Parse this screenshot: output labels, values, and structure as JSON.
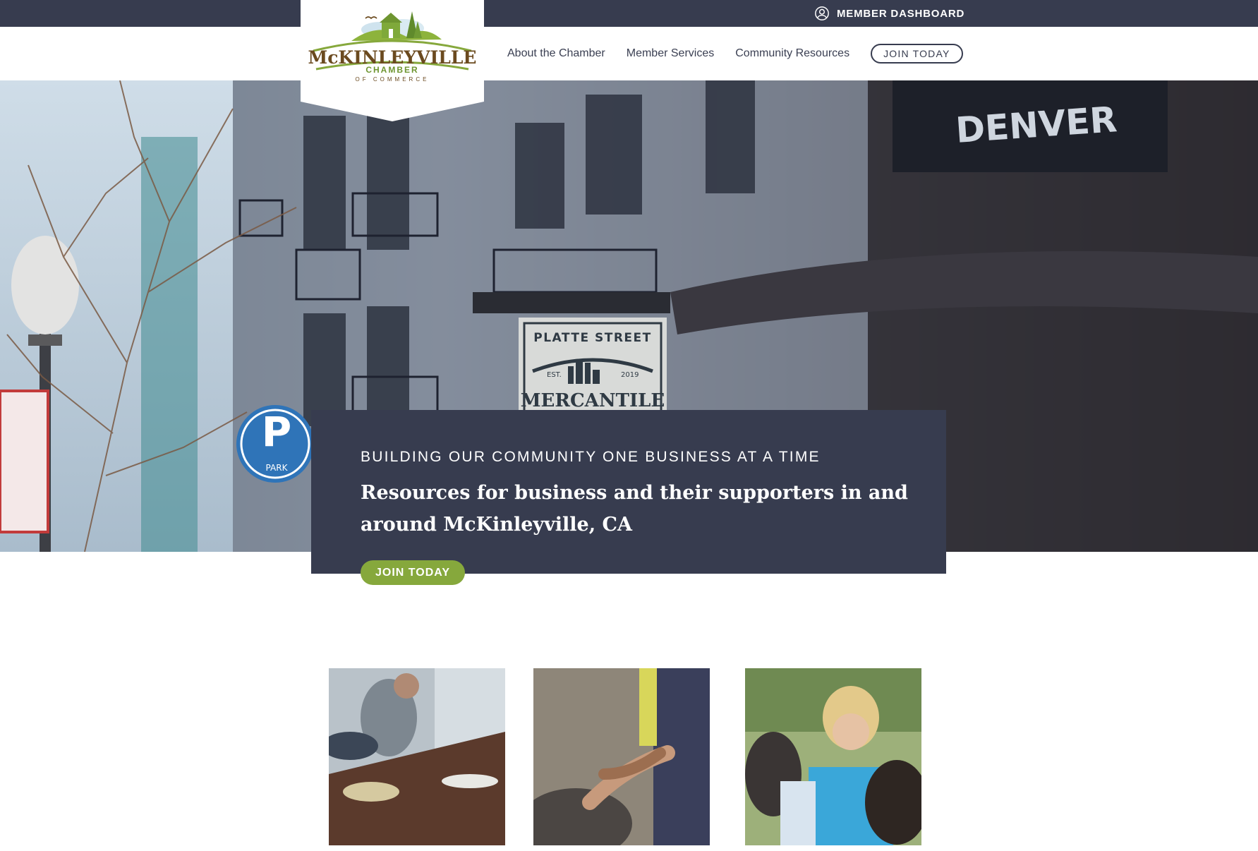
{
  "header": {
    "member_link": {
      "label": "MEMBER DASHBOARD",
      "icon": "user-circle-icon"
    },
    "logo": {
      "brand": "McKINLEYVILLE",
      "line2": "CHAMBER",
      "line3": "OF COMMERCE"
    },
    "nav": [
      {
        "label": "About the Chamber"
      },
      {
        "label": "Member Services"
      },
      {
        "label": "Community Resources"
      }
    ],
    "join_button": "JOIN TODAY"
  },
  "hero": {
    "kicker": "BUILDING OUR COMMUNITY ONE BUSINESS AT A TIME",
    "headline": "Resources for business and their supporters in and around McKinleyville, CA",
    "cta": "JOIN TODAY",
    "sign_text": {
      "line1": "PLATTE STREET",
      "est": "EST.",
      "year": "2019",
      "line2": "MERCANTILE",
      "upper_sign": "DENVER",
      "parking": "PARK"
    }
  },
  "colors": {
    "navy": "#373c4f",
    "green": "#86a83c",
    "logo_brown": "#6b4a1f"
  }
}
